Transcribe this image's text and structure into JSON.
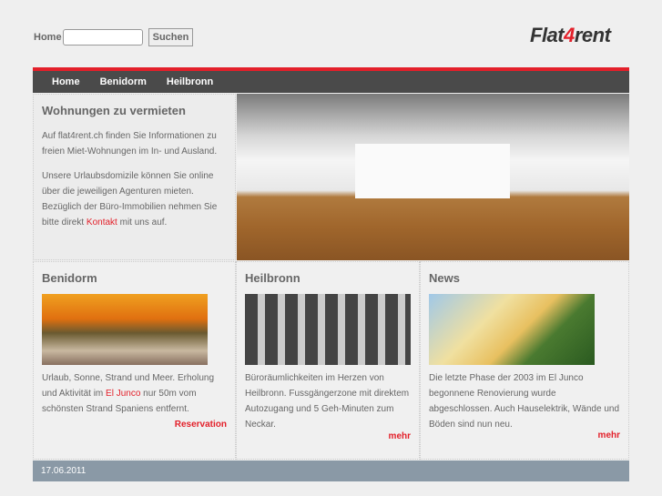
{
  "header": {
    "home_label": "Home",
    "search_placeholder": "",
    "search_button": "Suchen",
    "logo_a": "Flat",
    "logo_b": "4",
    "logo_c": "rent"
  },
  "nav": [
    "Home",
    "Benidorm",
    "Heilbronn"
  ],
  "intro": {
    "title": "Wohnungen zu vermieten",
    "p1": "Auf flat4rent.ch finden Sie Informationen zu freien Miet-Wohnungen im In- und Ausland.",
    "p2a": "Unsere Urlaubsdomizile können Sie online über die jeweiligen Agenturen mieten. Bezüglich der Büro-Immobilien nehmen Sie bitte direkt ",
    "p2link": "Kontakt",
    "p2b": " mit uns auf."
  },
  "columns": [
    {
      "title": "Benidorm",
      "ta": "Urlaub, Sonne, Strand und Meer. Erholung und Aktivität im ",
      "link": "El Junco",
      "tb": " nur 50m vom schönsten Strand Spaniens entfernt.",
      "more": "Reservation"
    },
    {
      "title": "Heilbronn",
      "text": "Büroräumlichkeiten im Herzen von Heilbronn. Fussgängerzone mit direktem Autozugang und 5 Geh-Minuten zum Neckar.",
      "more": "mehr"
    },
    {
      "title": "News",
      "text": "Die letzte Phase der 2003 im El Junco begonnene Renovierung wurde abgeschlossen. Auch Hauselektrik, Wände und Böden sind nun neu.",
      "more": "mehr"
    }
  ],
  "footer": {
    "date": "17.06.2011"
  }
}
